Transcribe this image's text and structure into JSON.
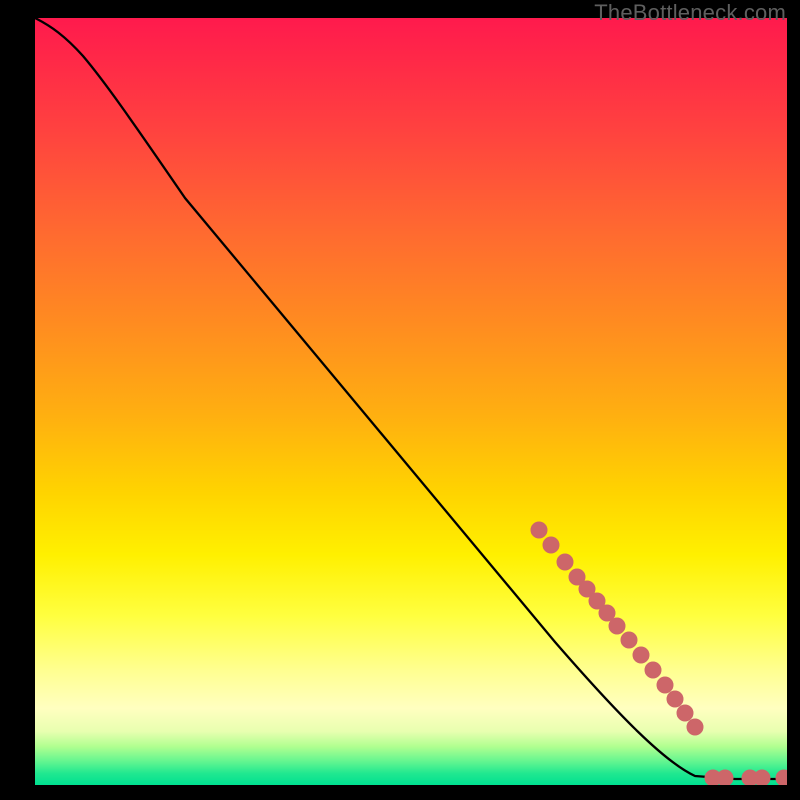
{
  "watermark": "TheBottleneck.com",
  "chart_data": {
    "type": "line",
    "title": "",
    "xlabel": "",
    "ylabel": "",
    "xlim": [
      0,
      100
    ],
    "ylim": [
      0,
      100
    ],
    "series": [
      {
        "name": "curve",
        "color": "#000000",
        "x": [
          0,
          2,
          5,
          9,
          14,
          20,
          30,
          40,
          50,
          60,
          68,
          76,
          82,
          86,
          88,
          90,
          92,
          95,
          98,
          100
        ],
        "y": [
          100,
          99,
          97.5,
          95,
          91,
          85,
          74,
          63,
          52,
          41,
          32,
          23,
          16,
          10,
          7,
          4,
          2,
          0.5,
          0.4,
          0.4
        ]
      },
      {
        "name": "markers-diagonal",
        "color": "#cd6669",
        "marker": "circle",
        "x": [
          67,
          69,
          71,
          72.5,
          74,
          75,
          76,
          77.5,
          79,
          80.5,
          82,
          83.5,
          85,
          86.5,
          88
        ],
        "y": [
          33,
          31,
          28.5,
          27,
          25,
          23.5,
          22,
          20.5,
          18.5,
          16.5,
          14.5,
          12.5,
          10.5,
          8.5,
          6.5
        ]
      },
      {
        "name": "markers-bottom",
        "color": "#cd6669",
        "marker": "circle",
        "x": [
          90,
          91.5,
          95,
          96.5,
          99.5
        ],
        "y": [
          0.5,
          0.5,
          0.5,
          0.5,
          0.5
        ]
      }
    ]
  }
}
